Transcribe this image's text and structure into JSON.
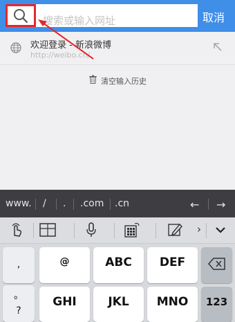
{
  "search": {
    "placeholder": "搜索或输入网址",
    "cancel_label": "取消"
  },
  "suggestion": {
    "title": "欢迎登录 - 新浪微博",
    "url": "http://weibo.cn/"
  },
  "history": {
    "clear_label": "清空输入历史"
  },
  "keyboard": {
    "url_keys": [
      "www.",
      "/",
      ".",
      ".com",
      ".cn"
    ],
    "nav_left": "←",
    "nav_right": "→",
    "side_keys": [
      ",",
      "。",
      "?"
    ],
    "row1": [
      "@",
      "ABC",
      "DEF"
    ],
    "row2": [
      "GHI",
      "JKL",
      "MNO"
    ],
    "num_key": "123",
    "tool_arrow": "›",
    "tool_hide": "⌄"
  },
  "colors": {
    "topbar": "#3f8ee8",
    "highlight_box": "#e6262a",
    "annotation_arrow": "#e6262a"
  }
}
